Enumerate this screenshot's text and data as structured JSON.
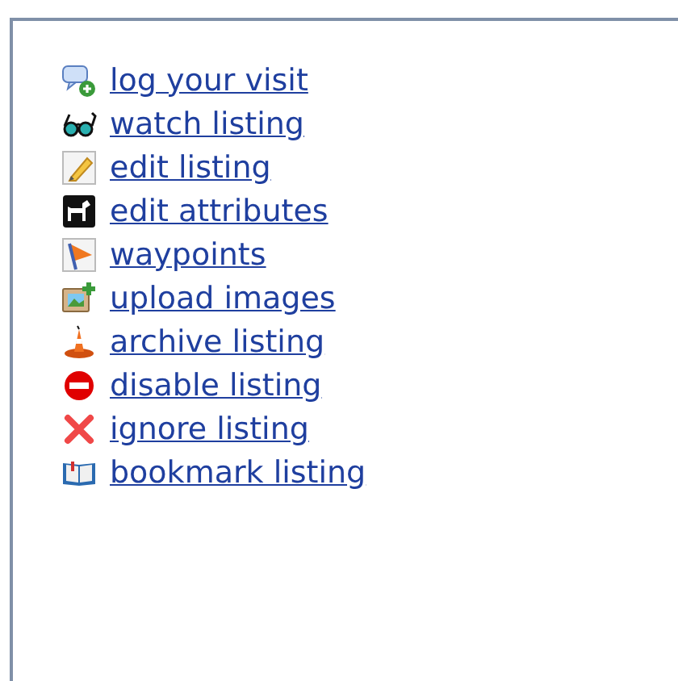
{
  "links": [
    {
      "kind": "log",
      "label": "log your visit"
    },
    {
      "kind": "watch",
      "label": "watch listing"
    },
    {
      "kind": "edit",
      "label": "edit listing"
    },
    {
      "kind": "attributes",
      "label": "edit attributes"
    },
    {
      "kind": "waypoints",
      "label": "waypoints"
    },
    {
      "kind": "upload",
      "label": "upload images"
    },
    {
      "kind": "archive",
      "label": "archive listing"
    },
    {
      "kind": "disable",
      "label": "disable listing"
    },
    {
      "kind": "ignore",
      "label": "ignore listing"
    },
    {
      "kind": "bookmark",
      "label": "bookmark listing"
    }
  ]
}
